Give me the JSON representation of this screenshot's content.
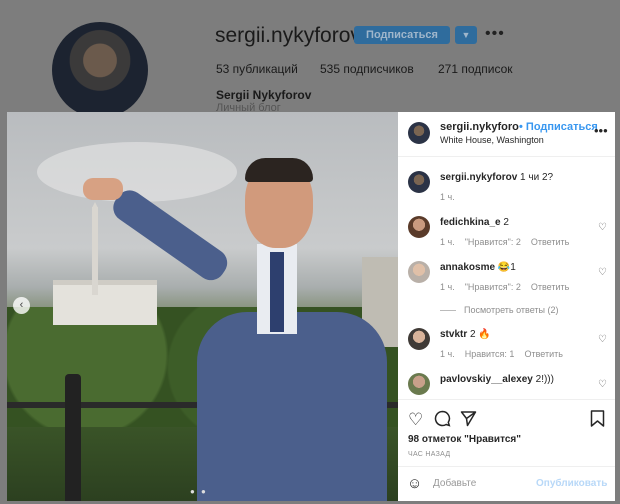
{
  "profile": {
    "username": "sergii.nykyforov",
    "follow_label": "Подписаться",
    "dropdown_icon": "chevron-down-icon",
    "more_icon": "more-horizontal-icon",
    "posts": "53 публикаций",
    "followers": "535 подписчиков",
    "following": "271 подписок",
    "full_name": "Sergii Nykyforov",
    "bio": "Личный блог"
  },
  "post": {
    "author": "sergii.nykyforo",
    "follow_label": "• Подписаться",
    "location": "White House, Washington",
    "caption_author": "sergii.nykyforov",
    "caption_text": "1 чи 2?",
    "caption_time": "1 ч.",
    "comments": [
      {
        "user": "fedichkina_e",
        "text": "2",
        "time": "1 ч.",
        "likes": "\"Нравится\": 2",
        "reply": "Ответить"
      },
      {
        "user": "annakosme",
        "text": "😂1",
        "time": "1 ч.",
        "likes": "\"Нравится\": 2",
        "reply": "Ответить"
      },
      {
        "user": "stvktr",
        "text": "2 🔥",
        "time": "1 ч.",
        "likes": "Нравится: 1",
        "reply": "Ответить"
      },
      {
        "user": "pavlovskiy__alexey",
        "text": "2!)))",
        "time": "",
        "likes": "",
        "reply": ""
      }
    ],
    "view_replies": "Посмотреть ответы (2)",
    "likes": "98 отметок \"Нравится\"",
    "time_ago": "ЧАС НАЗАД",
    "add_comment_placeholder": "Добавьте",
    "publish_label": "Опубликовать"
  },
  "icons": {
    "heart": "heart-icon",
    "comment": "comment-icon",
    "share": "share-icon",
    "bookmark": "bookmark-icon",
    "emoji": "emoji-icon",
    "nav_left": "chevron-left-icon"
  },
  "colors": {
    "accent": "#3897f0",
    "follow_button_dimmed": "#2f6c9d"
  }
}
